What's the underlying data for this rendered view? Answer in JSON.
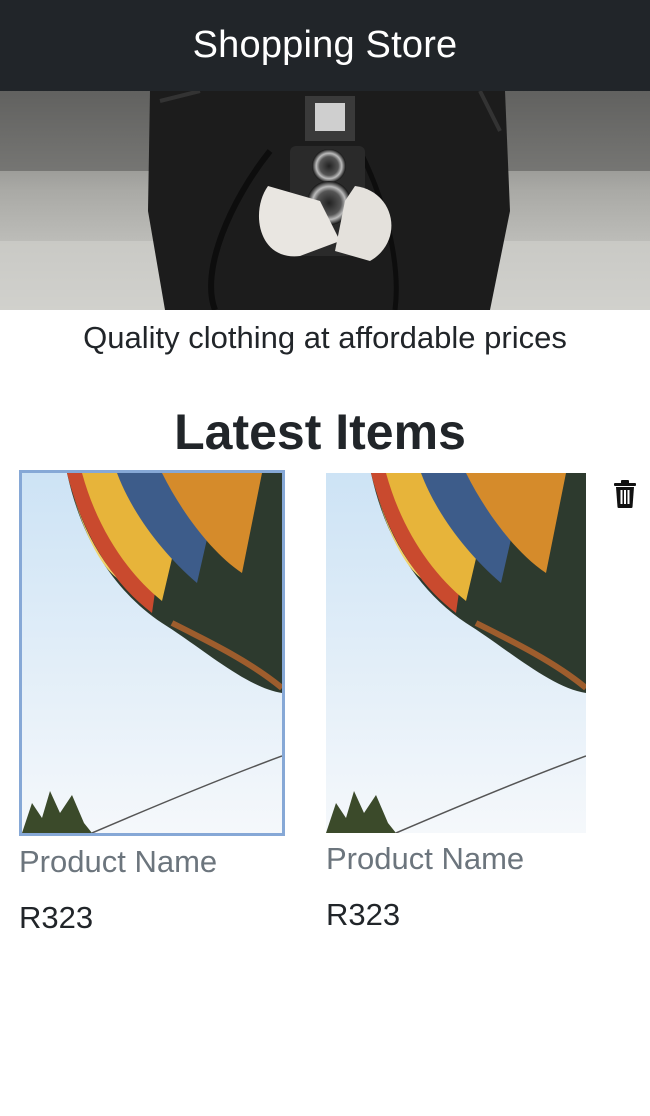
{
  "header": {
    "title": "Shopping Store"
  },
  "hero": {
    "tagline": "Quality clothing at affordable prices"
  },
  "section": {
    "title": "Latest Items"
  },
  "products": [
    {
      "name": "Product Name",
      "price": "R323",
      "image": "hot-air-balloon-image",
      "selected": true
    },
    {
      "name": "Product Name",
      "price": "R323",
      "image": "hot-air-balloon-image",
      "selected": false
    }
  ],
  "actions": {
    "delete_icon": "trash-icon"
  },
  "colors": {
    "navbar": "#212529",
    "selection_border": "#86a8d6",
    "muted_text": "#6c757d"
  }
}
